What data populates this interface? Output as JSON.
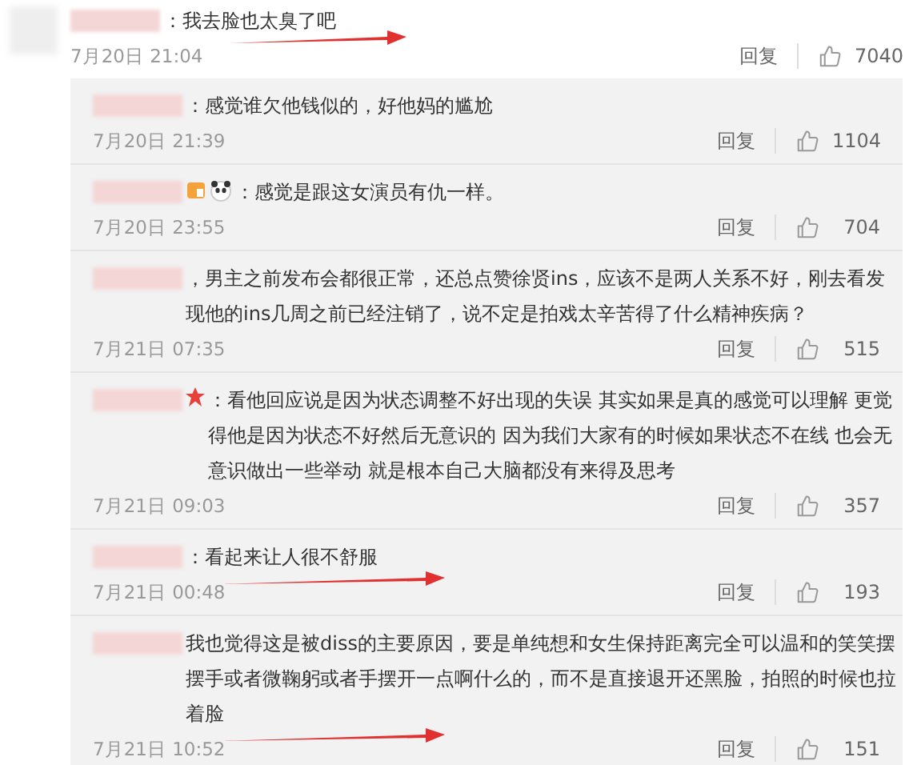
{
  "comments": [
    {
      "kind": "main",
      "text": "：我去脸也太臭了吧",
      "time": "7月20日 21:04",
      "reply": "回复",
      "likes": "7040",
      "arrow": true
    },
    {
      "kind": "reply",
      "text": "：感觉谁欠他钱似的，好他妈的尴尬",
      "time": "7月20日 21:39",
      "reply": "回复",
      "likes": "1104",
      "arrow": false
    },
    {
      "kind": "reply_medal_panda",
      "text": "：感觉是跟这女演员有仇一样。",
      "time": "7月20日 23:55",
      "reply": "回复",
      "likes": "704",
      "arrow": false
    },
    {
      "kind": "reply",
      "text": "，男主之前发布会都很正常，还总点赞徐贤ins，应该不是两人关系不好，刚去看发现他的ins几周之前已经注销了，说不定是拍戏太辛苦得了什么精神疾病？",
      "time": "7月21日 07:35",
      "reply": "回复",
      "likes": "515",
      "arrow": false
    },
    {
      "kind": "reply_star",
      "text": "：看他回应说是因为状态调整不好出现的失误 其实如果是真的感觉可以理解 更觉得他是因为状态不好然后无意识的 因为我们大家有的时候如果状态不在线 也会无意识做出一些举动 就是根本自己大脑都没有来得及思考",
      "time": "7月21日 09:03",
      "reply": "回复",
      "likes": "357",
      "arrow": false
    },
    {
      "kind": "reply",
      "text": "：看起来让人很不舒服",
      "time": "7月21日 00:48",
      "reply": "回复",
      "likes": "193",
      "arrow": true
    },
    {
      "kind": "reply",
      "text": "我也觉得这是被diss的主要原因，要是单纯想和女生保持距离完全可以温和的笑笑摆摆手或者微鞠躬或者手摆开一点啊什么的，而不是直接退开还黑脸，拍照的时候也拉着脸",
      "time": "7月21日 10:52",
      "reply": "回复",
      "likes": "151",
      "arrow": true
    }
  ]
}
